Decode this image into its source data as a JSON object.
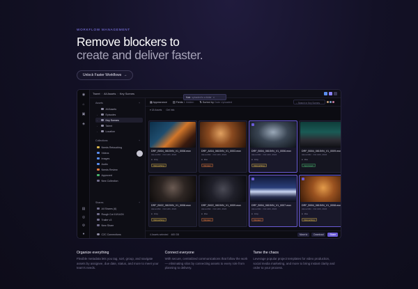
{
  "hero": {
    "eyebrow": "WORKFLOW MANAGEMENT",
    "headline_1": "Remove blockers to",
    "headline_2": "create and deliver faster.",
    "cta": "Unlock Faster Workflows",
    "cta_arrow": "→"
  },
  "app": {
    "breadcrumb": [
      "Tweet",
      "All Assets",
      "Key Scenes"
    ],
    "toast": {
      "title": "Katz",
      "text": "uploaded to a folder"
    },
    "sidebar": {
      "assets_header": "Assets",
      "assets": [
        {
          "label": "All Assets",
          "color": "#8e8ca3"
        },
        {
          "label": "Episodes",
          "color": "#8e8ca3"
        },
        {
          "label": "Key Scenes",
          "color": "#8e8ca3",
          "selected": true
        },
        {
          "label": "Talent",
          "color": "#8e8ca3"
        },
        {
          "label": "Location",
          "color": "#8e8ca3"
        }
      ],
      "collections_header": "Collections",
      "collections": [
        {
          "label": "Needs Retouching",
          "color": "#d9b44a"
        },
        {
          "label": "Videos",
          "color": "#5a8dee"
        },
        {
          "label": "Images",
          "color": "#5a8dee"
        },
        {
          "label": "Audio",
          "color": "#5a8dee"
        },
        {
          "label": "Needs Review",
          "color": "#e07a3f"
        },
        {
          "label": "Approved",
          "color": "#49b46e"
        },
        {
          "label": "New Collection",
          "color": "#6e6b88"
        }
      ],
      "shares_header": "Shares",
      "shares": [
        {
          "label": "All Shares (6)"
        },
        {
          "label": "Rough Cut 10/14/24"
        },
        {
          "label": "Trailer v3"
        },
        {
          "label": "New Share"
        }
      ],
      "footer": "C2C Connections"
    },
    "toolbar": {
      "appearance": "Appearance",
      "fields": "Fields",
      "fields_count": "1 hidden",
      "sorted": "Sorted by",
      "sorted_value": "Date Uploaded",
      "search_placeholder": "Search in Key Scenes"
    },
    "subbar": {
      "assets": "18 Assets",
      "filter": "Get Info"
    },
    "cards": [
      {
        "name": "DRF_B004_0815VN_V1_0008.mov",
        "meta": "Alexa Mini · Oct 14th, 2024",
        "row": "Amy",
        "badge": "Retouching",
        "badge_color": "#d9b44a",
        "selected": false,
        "thumb": "linear-gradient(135deg,#0c2f4a 0%,#1f4d6e 35%,#d1762a 55%,#3a1a0e 80%,#0d0d12 100%)"
      },
      {
        "name": "DRF_A016_0815VN_V1_0003.mov",
        "meta": "Alexa Mini · Oct 14th, 2024",
        "row": "Zoe",
        "badge": "Review",
        "badge_color": "#e07a3f",
        "selected": false,
        "thumb": "radial-gradient(circle at 45% 45%,#e0a060 0%,#8a4a20 40%,#2a1408 100%)"
      },
      {
        "name": "DRF_B004_0815VN_V1_0006.mov",
        "meta": "Alexa Mini · Oct 14th, 2024",
        "row": "Amy",
        "badge": "Retouching",
        "badge_color": "#d9b44a",
        "selected": true,
        "thumb": "radial-gradient(ellipse at 50% 40%,#9aa8b8 0%,#3a4553 45%,#0f141a 100%)"
      },
      {
        "name": "DRF_B004_0815VN_V1_0009.mov",
        "meta": "Alexa Mini · Oct 14th, 2024",
        "row": "Zoe",
        "badge": "Approved",
        "badge_color": "#49b46e",
        "selected": false,
        "thumb": "linear-gradient(180deg,#0f3d3a 0%,#1a5a55 40%,#2d2d34 70%,#0e0f14 100%)"
      },
      {
        "name": "DRF_B022_0815VN_V1_0008.mov",
        "meta": "Alexa Mini · Oct 14th, 2024",
        "row": "Amy",
        "badge": "Retouching",
        "badge_color": "#d9b44a",
        "selected": false,
        "thumb": "radial-gradient(circle at 50% 45%,#6a5a52 0%,#2e2623 45%,#0d0b0b 100%)"
      },
      {
        "name": "DRF_B022_0815VN_V1_0009.mov",
        "meta": "Alexa Mini · Oct 14th, 2024",
        "row": "Zoe",
        "badge": "Review",
        "badge_color": "#e07a3f",
        "selected": false,
        "thumb": "radial-gradient(circle at 50% 50%,#4a4a55 0%,#20202a 45%,#0c0c10 100%)"
      },
      {
        "name": "DRF_B004_0815VN_V1_0007.mov",
        "meta": "Alexa Mini · Oct 14th, 2024",
        "row": "Amy",
        "badge": "Review",
        "badge_color": "#e07a3f",
        "selected": true,
        "thumb": "linear-gradient(180deg,#121a3a 0%,#2a3f7a 45%,#c9d4f0 60%,#2a3050 80%,#0c0e1a 100%)"
      },
      {
        "name": "DRF_B004_0815VN_V1_0008.mov",
        "meta": "Alexa Mini · Oct 14th, 2024",
        "row": "Zoe",
        "badge": "Retouching",
        "badge_color": "#d9b44a",
        "selected": true,
        "thumb": "radial-gradient(circle at 50% 45%,#e39b4a 0%,#9a5220 40%,#3a1a08 100%)"
      }
    ],
    "bottombar": {
      "selected": "4 Assets selected",
      "size": "465 GB",
      "move": "Move to",
      "download": "Download",
      "share": "Share"
    }
  },
  "features": [
    {
      "title": "Organize everything",
      "body": "Flexible metadata lets you tag, sort, group, and navigate assets by assignee, due date, status, and more to meet your team's needs."
    },
    {
      "title": "Connect everyone",
      "body": "With secure, centralized communications that follow the work — eliminating silos by connecting assets to every role from planning to delivery."
    },
    {
      "title": "Tame the chaos",
      "body": "Leverage popular project templates for video production, social media marketing, and more to bring instant clarity and order to your process."
    }
  ]
}
